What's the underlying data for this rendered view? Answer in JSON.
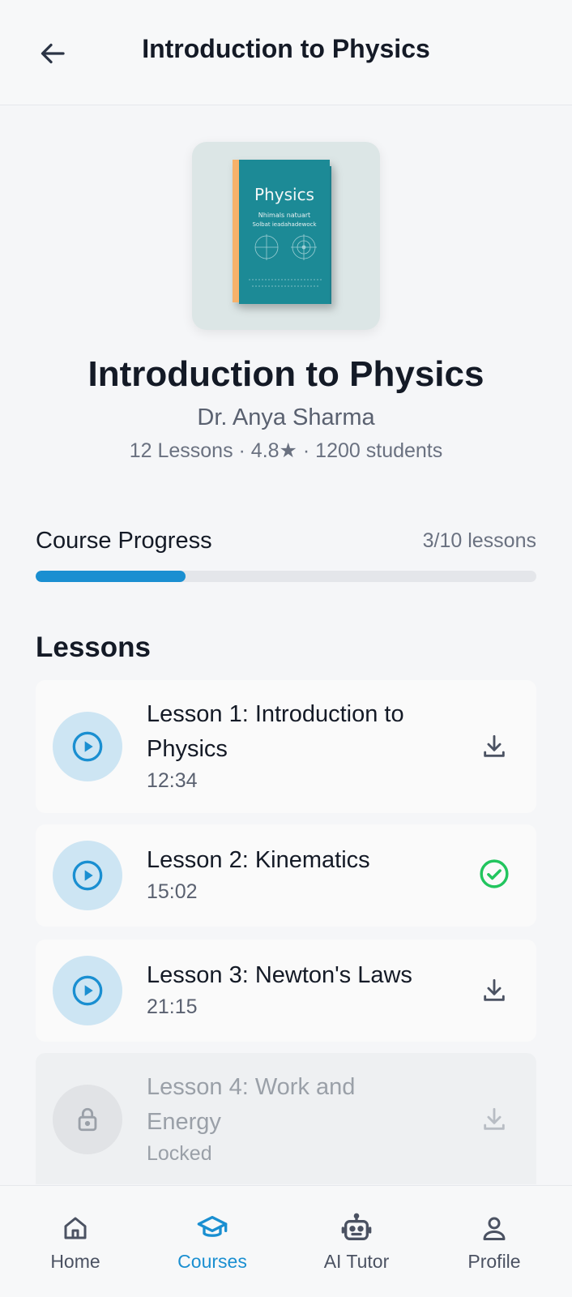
{
  "header": {
    "title": "Introduction to Physics"
  },
  "course": {
    "cover": {
      "book_title": "Physics",
      "book_subtitle_line1": "Nhimals natuart",
      "book_subtitle_line2": "Solbat ieadahadewock"
    },
    "title": "Introduction to Physics",
    "author": "Dr. Anya Sharma",
    "meta": "12 Lessons · 4.8★ · 1200 students"
  },
  "progress": {
    "label": "Course Progress",
    "count_text": "3/10 lessons",
    "fraction": 0.3
  },
  "lessons_section": {
    "title": "Lessons"
  },
  "lessons": [
    {
      "title_line1": "Lesson 1: Introduction to",
      "title_line2": "Physics",
      "subtitle": "12:34",
      "status": "download",
      "icon": "play-icon"
    },
    {
      "title_line1": "Lesson 2: Kinematics",
      "subtitle": "15:02",
      "status": "completed",
      "icon": "play-icon"
    },
    {
      "title_line1": "Lesson 3: Newton's Laws",
      "subtitle": "21:15",
      "status": "download",
      "icon": "play-icon"
    },
    {
      "title_line1": "Lesson 4: Work and",
      "title_line2": "Energy",
      "subtitle": "Locked",
      "status": "locked",
      "icon": "lock-icon"
    }
  ],
  "nav": {
    "items": [
      {
        "label": "Home",
        "icon": "home-icon",
        "active": false
      },
      {
        "label": "Courses",
        "icon": "graduation-cap-icon",
        "active": true
      },
      {
        "label": "AI Tutor",
        "icon": "robot-icon",
        "active": false
      },
      {
        "label": "Profile",
        "icon": "user-icon",
        "active": false
      }
    ]
  },
  "colors": {
    "accent": "#1a8fd1",
    "success": "#22c55e",
    "text_primary": "#141a26",
    "text_secondary": "#5a6170"
  }
}
